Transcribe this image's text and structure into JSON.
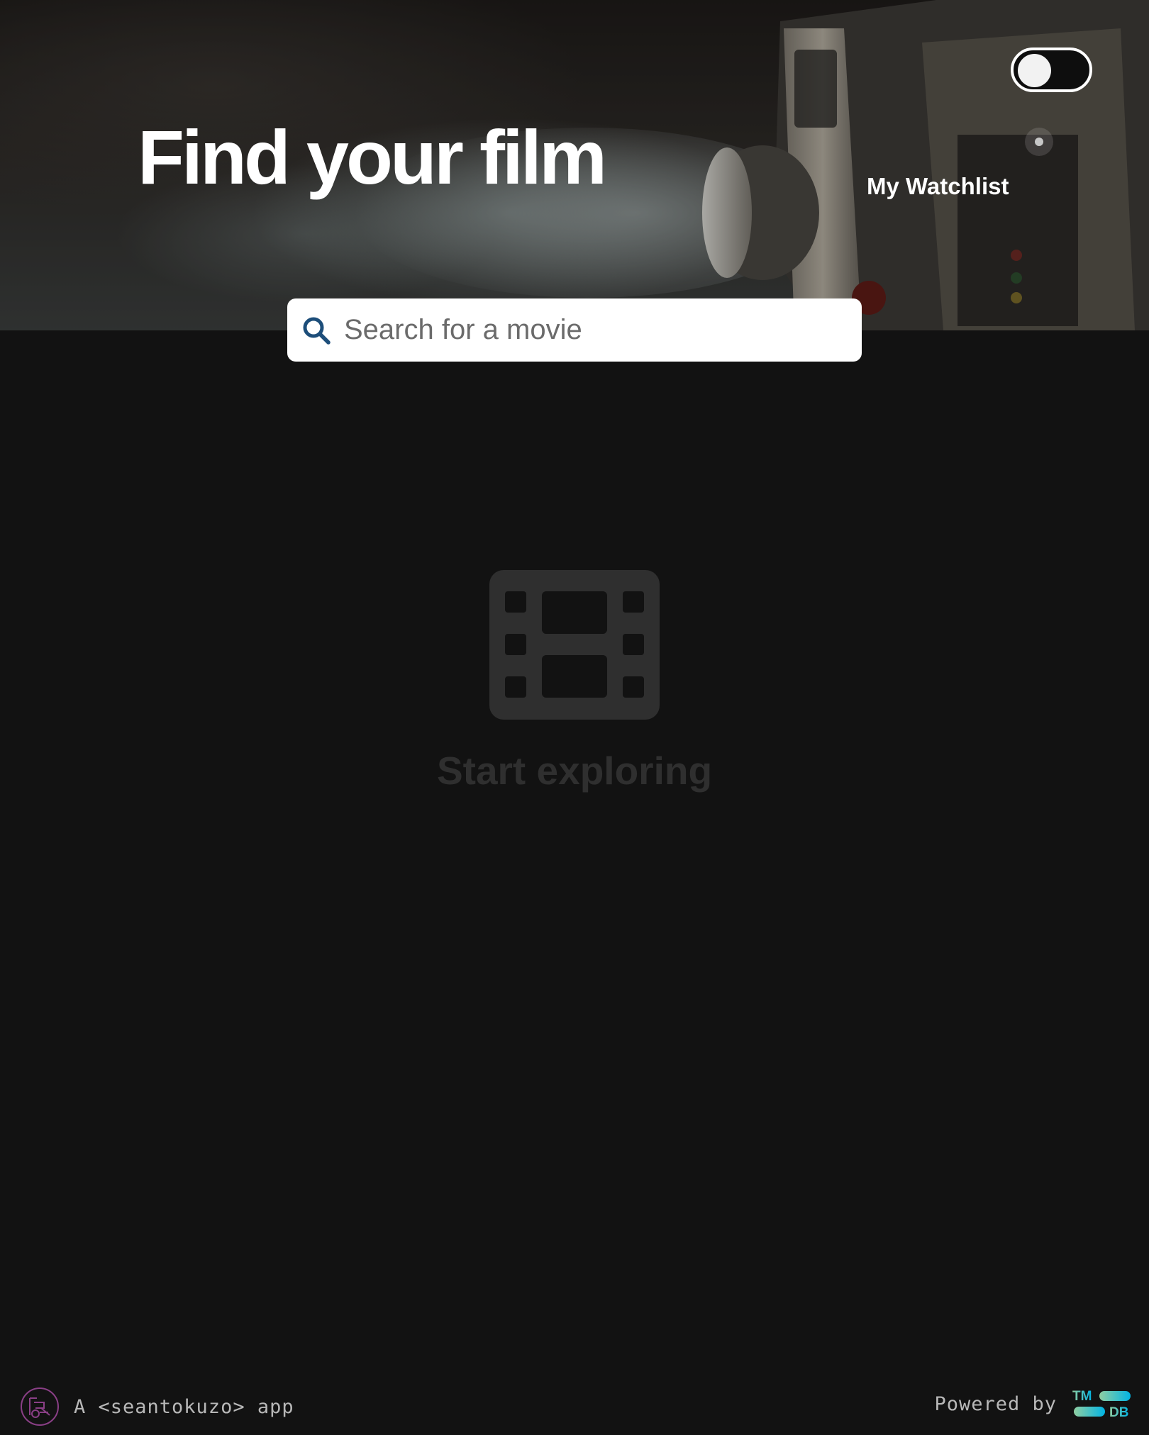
{
  "hero": {
    "title": "Find your film",
    "watchlist_label": "My Watchlist",
    "theme_toggle": {
      "state": "off"
    }
  },
  "search": {
    "placeholder": "Search for a movie",
    "value": "",
    "icon": "search-icon"
  },
  "empty_state": {
    "icon": "film-icon",
    "message": "Start exploring"
  },
  "footer": {
    "author_logo": "seantokuzo-logo",
    "credit": "A <seantokuzo> app",
    "powered_by": "Powered by",
    "provider_logo_text": {
      "top": "TM",
      "bottom": "DB"
    }
  },
  "colors": {
    "background": "#121212",
    "accent_blue": "#1d4e7a",
    "tmdb_teal": "#01b4e4",
    "tmdb_green": "#90cea1",
    "muted_icon": "#2f2f2f",
    "author_logo_purple": "#8a3f86"
  }
}
